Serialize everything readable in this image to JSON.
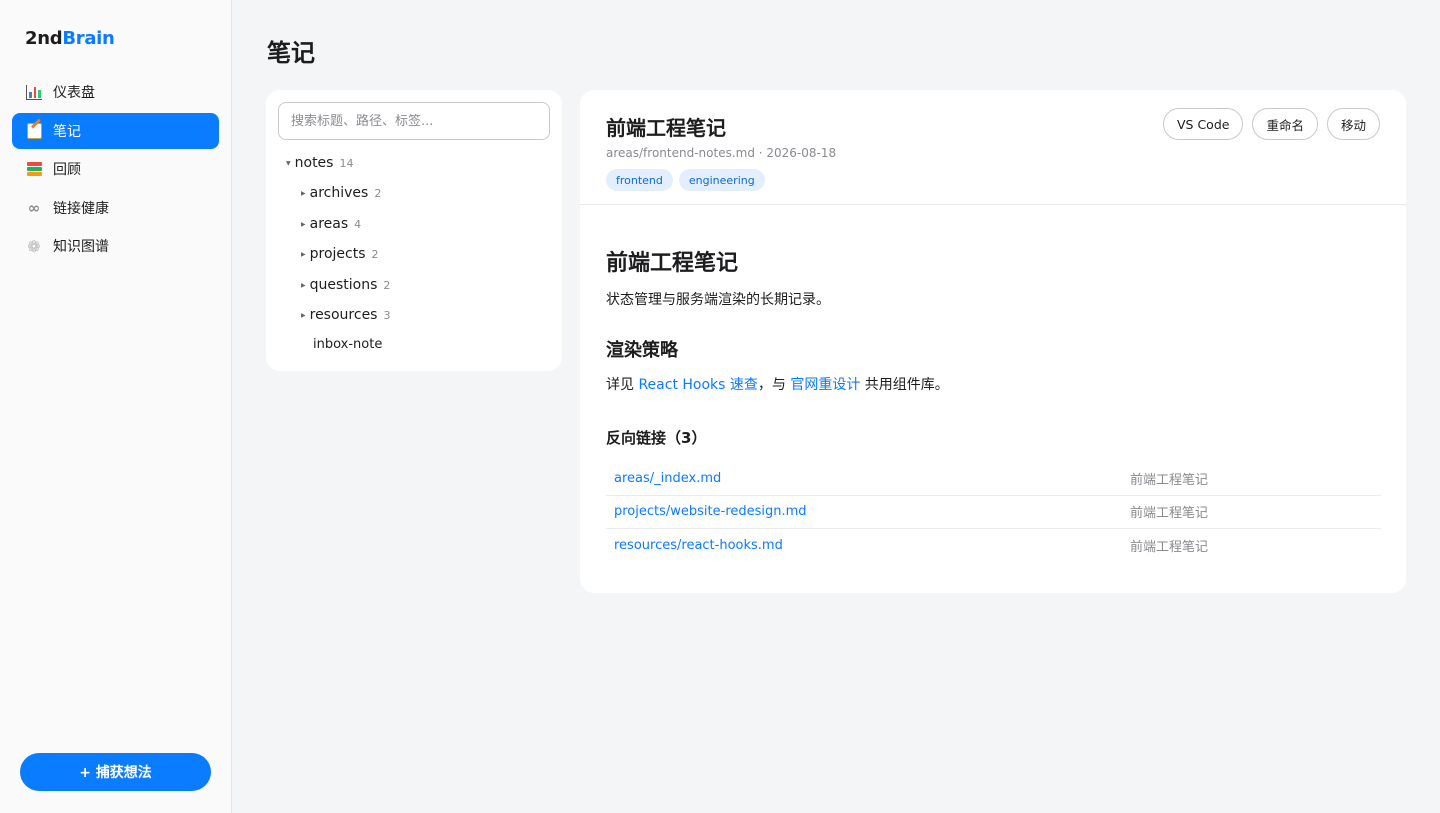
{
  "brand": {
    "part1": "2nd",
    "part2": "Brain"
  },
  "sidebar": {
    "items": [
      {
        "label": "仪表盘",
        "icon": "chart-icon",
        "active": false
      },
      {
        "label": "笔记",
        "icon": "memo-icon",
        "active": true
      },
      {
        "label": "回顾",
        "icon": "books-icon",
        "active": false
      },
      {
        "label": "链接健康",
        "icon": "link-icon",
        "active": false
      },
      {
        "label": "知识图谱",
        "icon": "web-icon",
        "active": false
      }
    ],
    "capture_label": "+ 捕获想法"
  },
  "page": {
    "title": "笔记"
  },
  "tree": {
    "search_placeholder": "搜索标题、路径、标签...",
    "root": {
      "label": "notes",
      "count": "14"
    },
    "folders": [
      {
        "label": "archives",
        "count": "2"
      },
      {
        "label": "areas",
        "count": "4"
      },
      {
        "label": "projects",
        "count": "2"
      },
      {
        "label": "questions",
        "count": "2"
      },
      {
        "label": "resources",
        "count": "3"
      }
    ],
    "leaf": "inbox-note"
  },
  "note": {
    "title": "前端工程笔记",
    "meta": "areas/frontend-notes.md · 2026-08-18",
    "tags": [
      "frontend",
      "engineering"
    ],
    "actions": {
      "vscode": "VS Code",
      "rename": "重命名",
      "move": "移动"
    },
    "body": {
      "h1": "前端工程笔记",
      "p1": "状态管理与服务端渲染的长期记录。",
      "h2": "渲染策略",
      "p2_prefix": "详见 ",
      "p2_link1": "React Hooks 速查",
      "p2_mid": "，与 ",
      "p2_link2": "官网重设计",
      "p2_suffix": " 共用组件库。"
    },
    "backlinks": {
      "title": "反向链接（3）",
      "rows": [
        {
          "path": "areas/_index.md",
          "target": "前端工程笔记"
        },
        {
          "path": "projects/website-redesign.md",
          "target": "前端工程笔记"
        },
        {
          "path": "resources/react-hooks.md",
          "target": "前端工程笔记"
        }
      ]
    }
  },
  "colors": {
    "accent": "#0a7cff",
    "background": "#f4f5f7",
    "tag_bg": "#e3efff"
  }
}
